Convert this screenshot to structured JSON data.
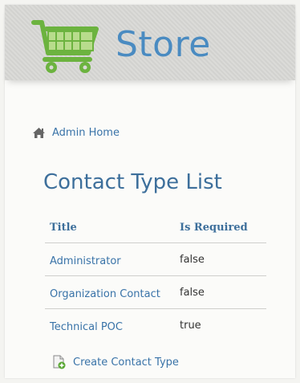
{
  "header": {
    "title": "Store",
    "logo_icon": "shopping-cart-icon",
    "colors": {
      "title": "#4a8bc1",
      "logo_green": "#6cb33f"
    }
  },
  "breadcrumb": {
    "icon": "home-icon",
    "label": "Admin Home"
  },
  "page": {
    "title": "Contact Type List"
  },
  "table": {
    "columns": [
      "Title",
      "Is Required"
    ],
    "rows": [
      {
        "title": "Administrator",
        "is_required": "false"
      },
      {
        "title": "Organization Contact",
        "is_required": "false"
      },
      {
        "title": "Technical POC",
        "is_required": "true"
      }
    ]
  },
  "actions": {
    "create_label": "Create Contact Type",
    "create_icon": "add-document-icon"
  }
}
